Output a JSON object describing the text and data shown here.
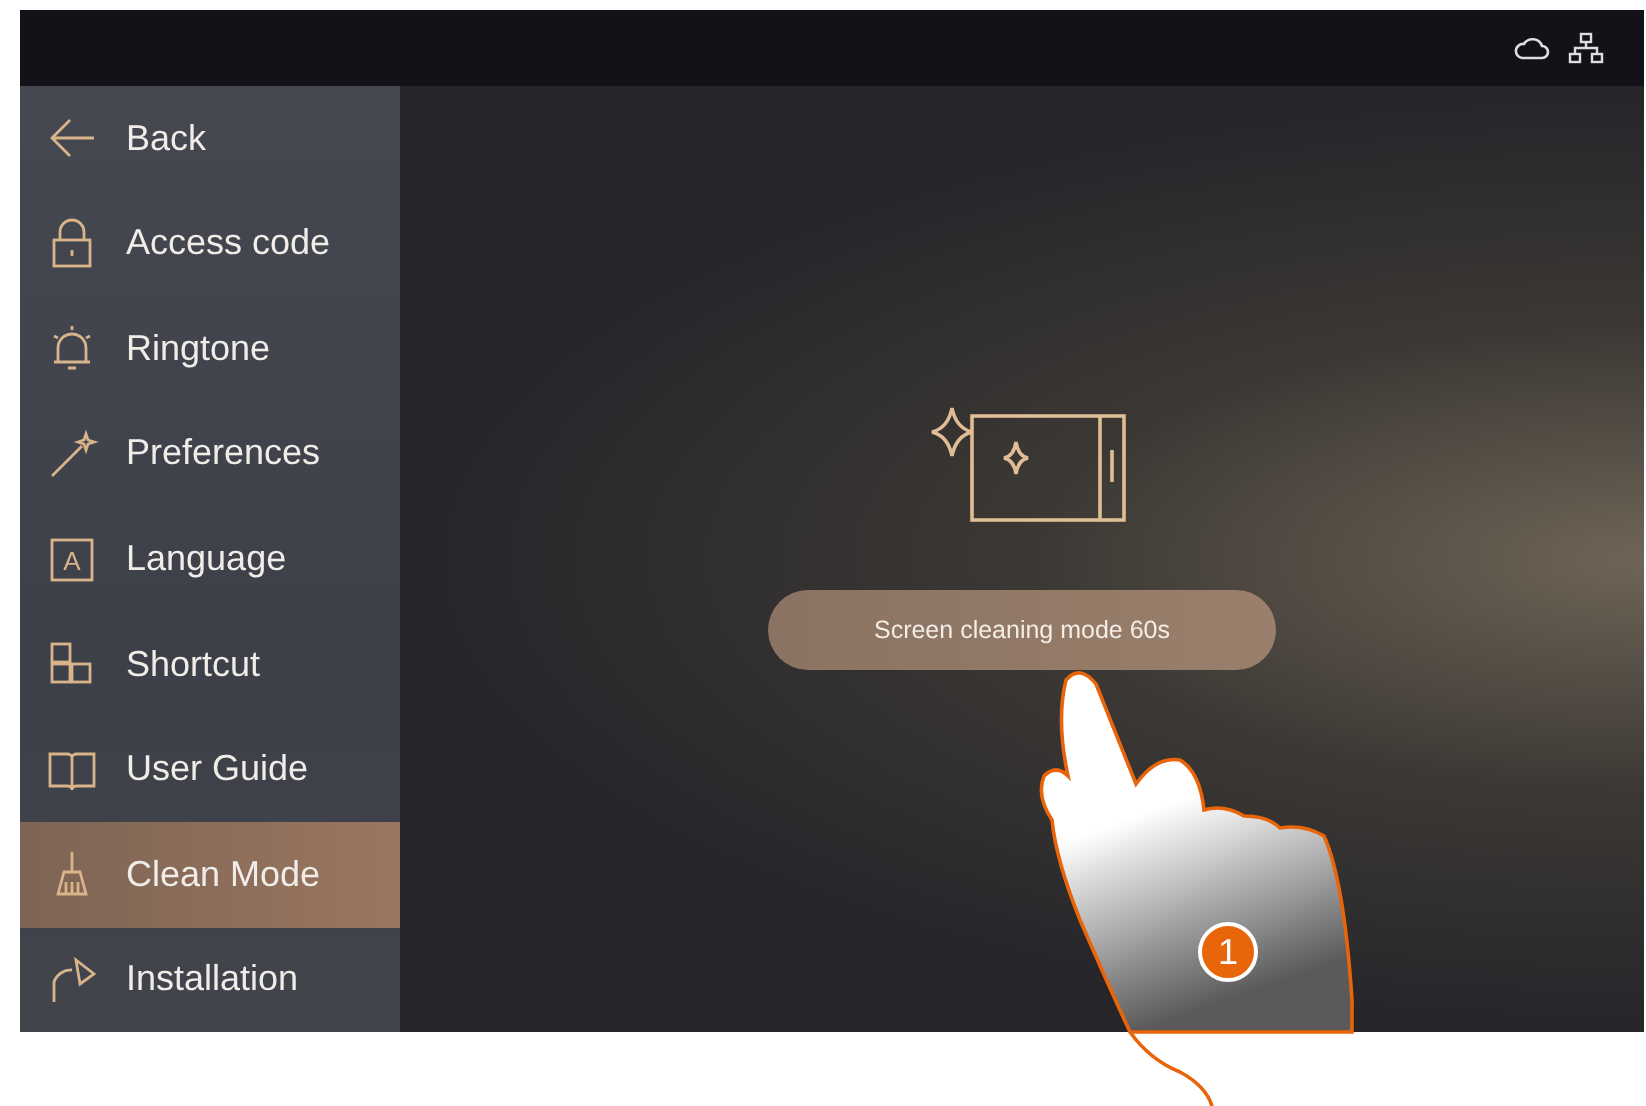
{
  "sidebar": {
    "items": [
      {
        "label": "Back",
        "selected": false
      },
      {
        "label": "Access code",
        "selected": false
      },
      {
        "label": "Ringtone",
        "selected": false
      },
      {
        "label": "Preferences",
        "selected": false
      },
      {
        "icon_letter": "A",
        "label": "Language",
        "selected": false
      },
      {
        "label": "Shortcut",
        "selected": false
      },
      {
        "label": "User Guide",
        "selected": false
      },
      {
        "label": "Clean Mode",
        "selected": true
      },
      {
        "label": "Installation",
        "selected": false
      }
    ]
  },
  "clean_mode": {
    "message": "Screen cleaning mode 60s"
  },
  "callout": {
    "step": "1"
  }
}
